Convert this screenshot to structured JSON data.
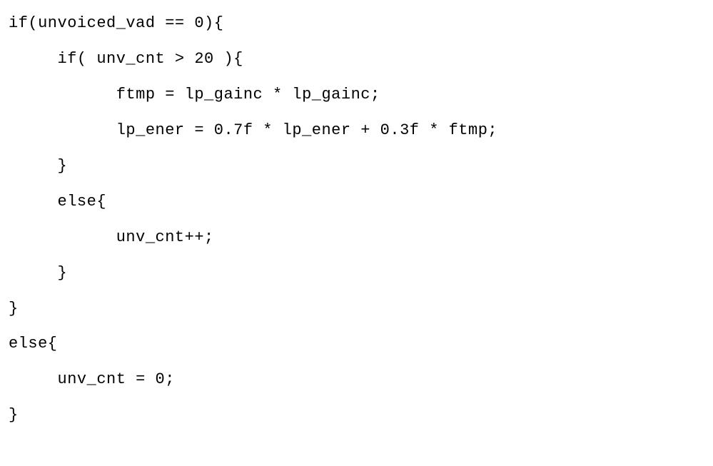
{
  "code": {
    "lines": [
      "if(unvoiced_vad == 0){",
      "     if( unv_cnt > 20 ){",
      "           ftmp = lp_gainc * lp_gainc;",
      "           lp_ener = 0.7f * lp_ener + 0.3f * ftmp;",
      "     }",
      "     else{",
      "           unv_cnt++;",
      "     }",
      "}",
      "else{",
      "     unv_cnt = 0;",
      "}"
    ]
  }
}
